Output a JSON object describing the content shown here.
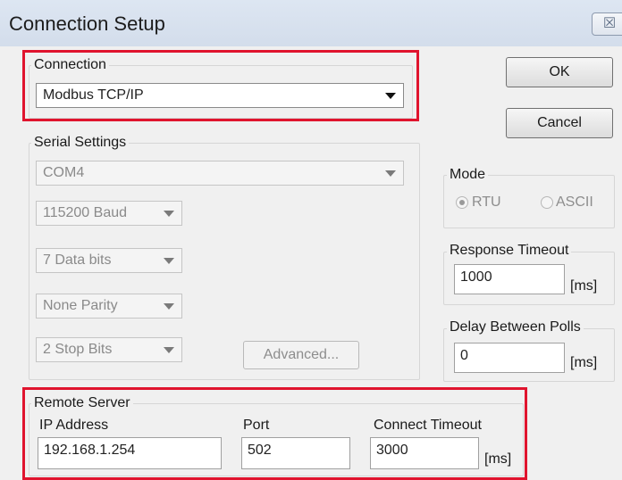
{
  "window": {
    "title": "Connection Setup",
    "close_glyph": "☒"
  },
  "connection": {
    "group_label": "Connection",
    "selected": "Modbus TCP/IP"
  },
  "buttons": {
    "ok": "OK",
    "cancel": "Cancel",
    "advanced": "Advanced..."
  },
  "serial": {
    "group_label": "Serial Settings",
    "port": "COM4",
    "baud": "115200 Baud",
    "data_bits": "7 Data bits",
    "parity": "None Parity",
    "stop_bits": "2 Stop Bits"
  },
  "mode": {
    "group_label": "Mode",
    "options": [
      "RTU",
      "ASCII"
    ],
    "selected": "RTU"
  },
  "response_timeout": {
    "label": "Response Timeout",
    "value": "1000",
    "unit": "[ms]"
  },
  "delay_between_polls": {
    "label": "Delay Between Polls",
    "value": "0",
    "unit": "[ms]"
  },
  "remote_server": {
    "group_label": "Remote Server",
    "ip_label": "IP Address",
    "ip_value": "192.168.1.254",
    "port_label": "Port",
    "port_value": "502",
    "connect_timeout_label": "Connect Timeout",
    "connect_timeout_value": "3000",
    "connect_timeout_unit": "[ms]"
  },
  "colors": {
    "highlight": "#e0142e",
    "titlebar": "#d6e0ee"
  }
}
